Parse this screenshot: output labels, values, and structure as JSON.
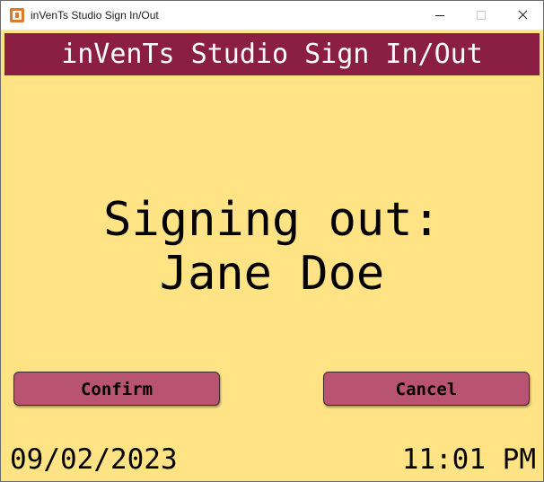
{
  "window": {
    "title": "inVenTs Studio Sign In/Out",
    "icon": "app-icon",
    "controls": [
      "minimize-icon",
      "maximize-icon",
      "close-icon"
    ]
  },
  "header": {
    "title": "inVenTs Studio Sign In/Out"
  },
  "message": {
    "line1": "Signing out:",
    "line2": "Jane Doe"
  },
  "actions": {
    "confirm_label": "Confirm",
    "cancel_label": "Cancel"
  },
  "footer": {
    "date": "09/02/2023",
    "time": "11:01 PM"
  },
  "colors": {
    "background": "#ffe385",
    "header": "#8a1f43",
    "button": "#b85472"
  }
}
